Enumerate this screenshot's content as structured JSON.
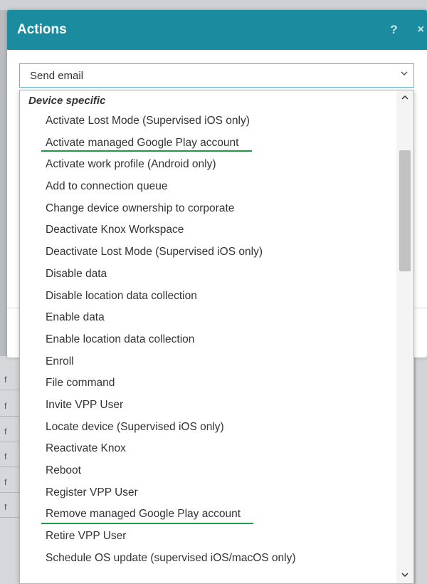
{
  "background": {
    "cells": [
      "f",
      "f",
      "f",
      "f",
      "f",
      "f"
    ]
  },
  "dialog": {
    "title": "Actions",
    "help_label": "?",
    "close_label": "×",
    "accent_color": "#1b8ba0"
  },
  "select": {
    "value": "Send email"
  },
  "dropdown": {
    "group_label": "Device specific",
    "options": [
      "Activate Lost Mode (Supervised iOS only)",
      "Activate managed Google Play account",
      "Activate work profile (Android only)",
      "Add to connection queue",
      "Change device ownership to corporate",
      "Deactivate Knox Workspace",
      "Deactivate Lost Mode (Supervised iOS only)",
      "Disable data",
      "Disable location data collection",
      "Enable data",
      "Enable location data collection",
      "Enroll",
      "File command",
      "Invite VPP User",
      "Locate device (Supervised iOS only)",
      "Reactivate Knox",
      "Reboot",
      "Register VPP User",
      "Remove managed Google Play account",
      "Retire VPP User",
      "Schedule OS update (supervised iOS/macOS only)"
    ],
    "highlight_color": "#1f9a4b"
  },
  "icons": {
    "chevron_down": "chevron-down-icon",
    "scroll_up": "chevron-up-icon",
    "scroll_down": "chevron-down-icon"
  }
}
